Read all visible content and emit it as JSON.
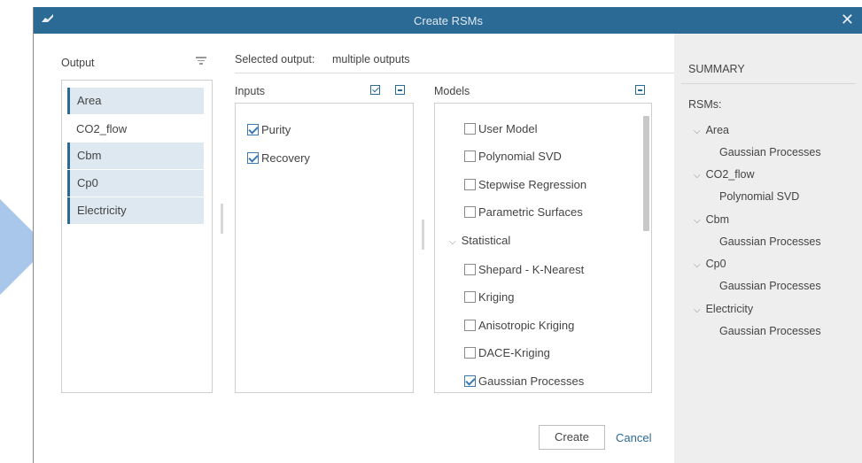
{
  "dialog": {
    "title": "Create RSMs"
  },
  "output_panel": {
    "label": "Output",
    "items": [
      {
        "label": "Area",
        "selected": true
      },
      {
        "label": "CO2_flow",
        "selected": false
      },
      {
        "label": "Cbm",
        "selected": true
      },
      {
        "label": "Cp0",
        "selected": true
      },
      {
        "label": "Electricity",
        "selected": true
      }
    ]
  },
  "selected_output": {
    "label": "Selected output:",
    "value": "multiple outputs"
  },
  "inputs_panel": {
    "label": "Inputs",
    "items": [
      {
        "label": "Purity",
        "checked": true
      },
      {
        "label": "Recovery",
        "checked": true
      }
    ]
  },
  "models_panel": {
    "label": "Models",
    "items": [
      {
        "label": "User Model",
        "checked": false
      },
      {
        "label": "Polynomial SVD",
        "checked": false
      },
      {
        "label": "Stepwise Regression",
        "checked": false
      },
      {
        "label": "Parametric Surfaces",
        "checked": false
      },
      {
        "label": "Statistical",
        "group": true
      },
      {
        "label": "Shepard - K-Nearest",
        "checked": false
      },
      {
        "label": "Kriging",
        "checked": false
      },
      {
        "label": "Anisotropic Kriging",
        "checked": false
      },
      {
        "label": "DACE-Kriging",
        "checked": false
      },
      {
        "label": "Gaussian Processes",
        "checked": true
      }
    ]
  },
  "summary": {
    "title": "SUMMARY",
    "rsms_label": "RSMs:",
    "entries": [
      {
        "output": "Area",
        "model": "Gaussian Processes"
      },
      {
        "output": "CO2_flow",
        "model": "Polynomial SVD"
      },
      {
        "output": "Cbm",
        "model": "Gaussian Processes"
      },
      {
        "output": "Cp0",
        "model": "Gaussian Processes"
      },
      {
        "output": "Electricity",
        "model": "Gaussian Processes"
      }
    ]
  },
  "buttons": {
    "create": "Create",
    "cancel": "Cancel"
  },
  "colors": {
    "titlebar": "#2c6a96",
    "accent": "#2c6a96",
    "selection": "#dde8f0",
    "summary_bg": "#eeeeee"
  }
}
